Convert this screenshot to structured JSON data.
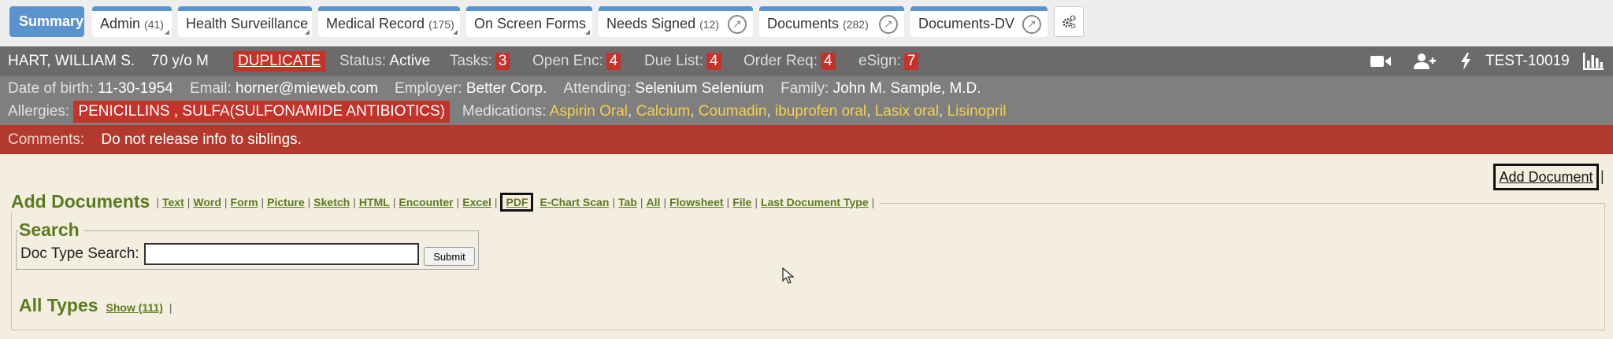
{
  "tabs": [
    {
      "label": "Summary",
      "count": ""
    },
    {
      "label": "Admin",
      "count": "(41)"
    },
    {
      "label": "Health Surveillance",
      "count": ""
    },
    {
      "label": "Medical Record",
      "count": "(175)"
    },
    {
      "label": "On Screen Forms",
      "count": ""
    },
    {
      "label": "Needs Signed",
      "count": "(12)"
    },
    {
      "label": "Documents",
      "count": "(282)"
    },
    {
      "label": "Documents-DV",
      "count": ""
    }
  ],
  "patient": {
    "name": "HART, WILLIAM S.",
    "age_sex": "70 y/o M",
    "duplicate": "DUPLICATE",
    "status_label": "Status:",
    "status_value": "Active",
    "tasks_label": "Tasks:",
    "tasks_value": "3",
    "open_enc_label": "Open Enc:",
    "open_enc_value": "4",
    "due_list_label": "Due List:",
    "due_list_value": "4",
    "order_req_label": "Order Req:",
    "order_req_value": "4",
    "esign_label": "eSign:",
    "esign_value": "7",
    "record_id": "TEST-10019"
  },
  "details": {
    "dob_label": "Date of birth:",
    "dob_value": "11-30-1954",
    "email_label": "Email:",
    "email_value": "horner@mieweb.com",
    "employer_label": "Employer:",
    "employer_value": "Better Corp.",
    "attending_label": "Attending:",
    "attending_value": "Selenium Selenium",
    "family_label": "Family:",
    "family_value": "John M. Sample, M.D.",
    "allergies_label": "Allergies:",
    "allergies_value": "PENICILLINS , SULFA(SULFONAMIDE ANTIBIOTICS)",
    "medications_label": "Medications:",
    "medications": [
      "Aspirin Oral",
      "Calcium",
      "Coumadin",
      "ibuprofen oral",
      "Lasix oral",
      "Lisinopril"
    ]
  },
  "comments": {
    "label": "Comments:",
    "value": "Do not release info to siblings."
  },
  "add_documents": {
    "add_button": "Add Document",
    "title": "Add Documents",
    "links": [
      "Text",
      "Word",
      "Form",
      "Picture",
      "Sketch",
      "HTML",
      "Encounter",
      "Excel",
      "PDF",
      "E-Chart Scan",
      "Tab",
      "All",
      "Flowsheet",
      "File",
      "Last Document Type"
    ]
  },
  "search": {
    "title": "Search",
    "label": "Doc Type Search:",
    "value": "",
    "submit": "Submit"
  },
  "all_types": {
    "title": "All Types",
    "show": "Show (111)"
  },
  "colors": {
    "tab_blue": "#5b93cf",
    "alert_red": "#c4332a",
    "med_yellow": "#f3d14c",
    "heading_green": "#5b7b1f",
    "page_bg": "#f4eee0"
  }
}
